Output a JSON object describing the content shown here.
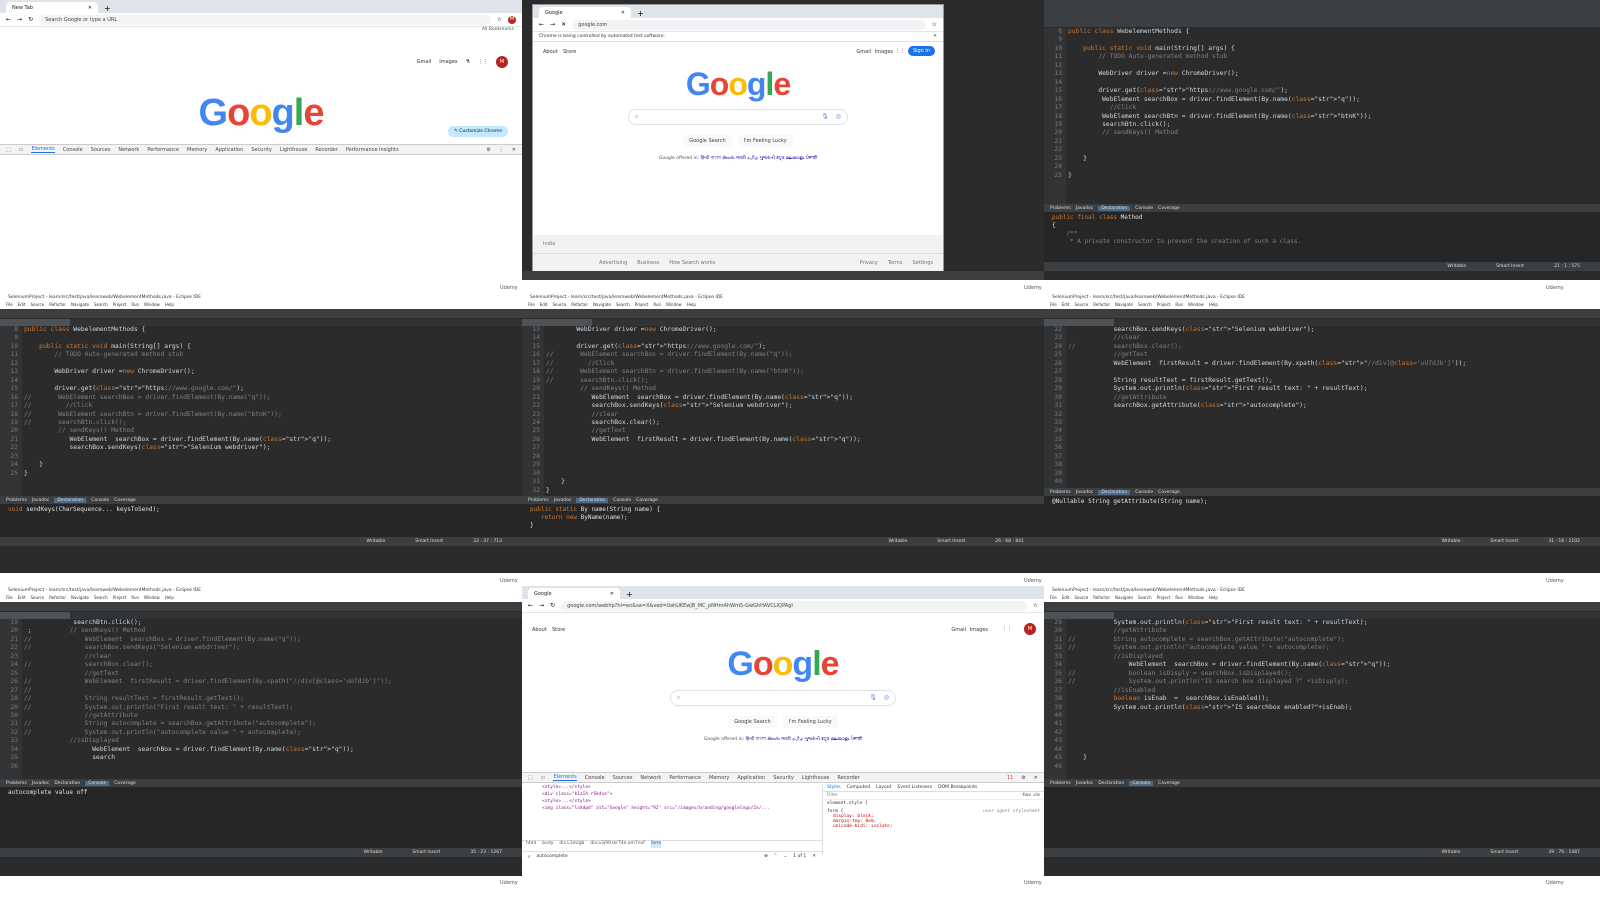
{
  "watermark": "Udemy",
  "tile1": {
    "tab_title": "New Tab",
    "omnibox_placeholder": "Search Google or type a URL",
    "all_bookmarks": "All Bookmarks",
    "top_links": [
      "Gmail",
      "Images"
    ],
    "avatar_letter": "M",
    "customize_button": "Customize Chrome",
    "devtools_tabs": [
      "Elements",
      "Console",
      "Sources",
      "Network",
      "Performance",
      "Memory",
      "Application",
      "Security",
      "Lighthouse",
      "Recorder",
      "Performance insights"
    ]
  },
  "tile2": {
    "tab_title": "Google",
    "url": "google.com",
    "automation_notice": "Chrome is being controlled by automated test software.",
    "top_left_links": [
      "About",
      "Store"
    ],
    "top_right_links": [
      "Gmail",
      "Images"
    ],
    "sign_in": "Sign in",
    "buttons": [
      "Google Search",
      "I'm Feeling Lucky"
    ],
    "offered_in_label": "Google offered in:",
    "languages": [
      "हिन्दी",
      "বাংলা",
      "తెలుగు",
      "मराठी",
      "தமிழ்",
      "ગુજરાતી",
      "ಕನ್ನಡ",
      "മലയാളം",
      "ਪੰਜਾਬੀ"
    ],
    "country": "India",
    "footer_left": [
      "Advertising",
      "Business",
      "How Search works"
    ],
    "footer_right": [
      "Privacy",
      "Terms",
      "Settings"
    ]
  },
  "tile3": {
    "code_lines": [
      {
        "n": "8",
        "t": "public class WebelementMethods {"
      },
      {
        "n": "9",
        "t": ""
      },
      {
        "n": "10",
        "t": "    public static void main(String[] args) {"
      },
      {
        "n": "11",
        "t": "        // TODO Auto-generated method stub"
      },
      {
        "n": "12",
        "t": ""
      },
      {
        "n": "13",
        "t": "        WebDriver driver =new ChromeDriver();"
      },
      {
        "n": "14",
        "t": ""
      },
      {
        "n": "15",
        "t": "        driver.get(\"https://www.google.com/\");"
      },
      {
        "n": "16",
        "t": "         WebElement searchBox = driver.findElement(By.name(\"q\"));"
      },
      {
        "n": "17",
        "t": "           //Click"
      },
      {
        "n": "18",
        "t": "         WebElement searchBtn = driver.findElement(By.name(\"btnK\"));"
      },
      {
        "n": "19",
        "t": "         searchBtn.click();"
      },
      {
        "n": "20",
        "t": "         // sendKeys() Method"
      },
      {
        "n": "21",
        "t": ""
      },
      {
        "n": "22",
        "t": ""
      },
      {
        "n": "23",
        "t": "    }"
      },
      {
        "n": "24",
        "t": ""
      },
      {
        "n": "25",
        "t": "}"
      }
    ],
    "bottom_tabs": [
      "Problems",
      "Javadoc",
      "Declaration",
      "Console",
      "Coverage"
    ],
    "console_lines": [
      "public final class Method",
      "{",
      "    /**",
      "     * A private constructor to prevent the creation of such a class."
    ],
    "status": [
      "Writable",
      "Smart Insert",
      "21 : 1 : 575"
    ]
  },
  "tile4": {
    "title": "SeleniumProject - learn/src/test/java/learnweb/WebelementMethods.java - Eclipse IDE",
    "menu": [
      "File",
      "Edit",
      "Source",
      "Refactor",
      "Navigate",
      "Search",
      "Project",
      "Run",
      "Window",
      "Help"
    ],
    "code_lines": [
      {
        "n": "8",
        "t": "public class WebelementMethods {"
      },
      {
        "n": "9",
        "t": ""
      },
      {
        "n": "10",
        "t": "    public static void main(String[] args) {"
      },
      {
        "n": "11",
        "t": "        // TODO Auto-generated method stub"
      },
      {
        "n": "12",
        "t": ""
      },
      {
        "n": "13",
        "t": "        WebDriver driver =new ChromeDriver();"
      },
      {
        "n": "14",
        "t": ""
      },
      {
        "n": "15",
        "t": "        driver.get(\"https://www.google.com/\");"
      },
      {
        "n": "16",
        "t": "//       WebElement searchBox = driver.findElement(By.name(\"q\"));"
      },
      {
        "n": "17",
        "t": "//         //Click"
      },
      {
        "n": "18",
        "t": "//       WebElement searchBtn = driver.findElement(By.name(\"btnK\"));"
      },
      {
        "n": "19",
        "t": "//       searchBtn.click();"
      },
      {
        "n": "20",
        "t": "         // sendKeys() Method"
      },
      {
        "n": "21",
        "t": "            WebElement  searchBox = driver.findElement(By.name(\"q\"));"
      },
      {
        "n": "22",
        "t": "            searchBox.sendKeys(\"Selenium webdriver\");"
      },
      {
        "n": "23",
        "t": ""
      },
      {
        "n": "24",
        "t": "    }"
      },
      {
        "n": "25",
        "t": "}"
      }
    ],
    "console_lines": [
      "void sendKeys(CharSequence... keysToSend);"
    ],
    "status": [
      "Writable",
      "Smart Insert",
      "22 : 37 : 713"
    ]
  },
  "tile5": {
    "code_lines": [
      {
        "n": "13",
        "t": "        WebDriver driver =new ChromeDriver();"
      },
      {
        "n": "14",
        "t": ""
      },
      {
        "n": "15",
        "t": "        driver.get(\"https://www.google.com/\");"
      },
      {
        "n": "16",
        "t": "//       WebElement searchBox = driver.findElement(By.name(\"q\"));"
      },
      {
        "n": "17",
        "t": "//         //Click"
      },
      {
        "n": "18",
        "t": "//       WebElement searchBtn = driver.findElement(By.name(\"btnK\"));"
      },
      {
        "n": "19",
        "t": "//       searchBtn.click();"
      },
      {
        "n": "20",
        "t": "         // sendKeys() Method"
      },
      {
        "n": "21",
        "t": "            WebElement  searchBox = driver.findElement(By.name(\"q\"));"
      },
      {
        "n": "22",
        "t": "            searchBox.sendKeys(\"Selenium webdriver\");"
      },
      {
        "n": "23",
        "t": "            //clear"
      },
      {
        "n": "24",
        "t": "            searchBox.clear();"
      },
      {
        "n": "25",
        "t": "            //getText"
      },
      {
        "n": "26",
        "t": "            WebElement  firstResult = driver.findElement(By.name(\"q\"));"
      },
      {
        "n": "27",
        "t": ""
      },
      {
        "n": "28",
        "t": ""
      },
      {
        "n": "29",
        "t": ""
      },
      {
        "n": "30",
        "t": ""
      },
      {
        "n": "31",
        "t": "    }"
      },
      {
        "n": "32",
        "t": "}"
      }
    ],
    "console_lines": [
      "public static By name(String name) {",
      "   return new ByName(name);",
      "}"
    ],
    "status": [
      "Writable",
      "Smart Insert",
      "26 : 68 : 841"
    ]
  },
  "tile6": {
    "code_lines": [
      {
        "n": "22",
        "t": "            searchBox.sendKeys(\"Selenium webdriver\");"
      },
      {
        "n": "23",
        "t": "            //clear"
      },
      {
        "n": "24",
        "t": "//          searchBox.clear();"
      },
      {
        "n": "25",
        "t": "            //getText"
      },
      {
        "n": "26",
        "t": "            WebElement  firstResult = driver.findElement(By.xpath(\"//div[@class='uU7dJb']\"));"
      },
      {
        "n": "27",
        "t": ""
      },
      {
        "n": "28",
        "t": "            String resultText = firstResult.getText();"
      },
      {
        "n": "29",
        "t": "            System.out.println(\"First result text: \" + resultText);"
      },
      {
        "n": "30",
        "t": "            //getAttribute"
      },
      {
        "n": "31",
        "t": "            searchBox.getAttribute(\"autocomplete\");"
      },
      {
        "n": "32",
        "t": ""
      },
      {
        "n": "33",
        "t": ""
      },
      {
        "n": "34",
        "t": ""
      },
      {
        "n": "35",
        "t": ""
      },
      {
        "n": "36",
        "t": ""
      },
      {
        "n": "37",
        "t": ""
      },
      {
        "n": "38",
        "t": ""
      },
      {
        "n": "39",
        "t": ""
      },
      {
        "n": "40",
        "t": ""
      }
    ],
    "console_lines": [
      "@Nullable String getAttribute(String name);"
    ],
    "status": [
      "Writable",
      "Smart Insert",
      "31 : 16 : 1102"
    ]
  },
  "tile7": {
    "code_lines": [
      {
        "n": "19",
        "t": "             searchBtn.click();"
      },
      {
        "n": "20",
        "t": " ;          // sendKeys() Method"
      },
      {
        "n": "21",
        "t": "//              WebElement  searchBox = driver.findElement(By.name(\"q\"));"
      },
      {
        "n": "22",
        "t": "//              searchBox.sendKeys(\"Selenium webdriver\");"
      },
      {
        "n": "23",
        "t": "                //clear"
      },
      {
        "n": "24",
        "t": "//              searchBox.clear();"
      },
      {
        "n": "25",
        "t": "                //getText"
      },
      {
        "n": "26",
        "t": "//              WebElement  firstResult = driver.findElement(By.xpath(\"//div[@class='uU7dJb']\"));"
      },
      {
        "n": "27",
        "t": "//"
      },
      {
        "n": "28",
        "t": "//              String resultText = firstResult.getText();"
      },
      {
        "n": "29",
        "t": "//              System.out.println(\"First result text: \" + resultText);"
      },
      {
        "n": "30",
        "t": "                //getAttribute"
      },
      {
        "n": "31",
        "t": "//              String autocomplete = searchBox.getAttribute(\"autocomplete\");"
      },
      {
        "n": "32",
        "t": "//              System.out.println(\"autocomplete value \" + autocomplete);"
      },
      {
        "n": "33",
        "t": "            //isDisplayed"
      },
      {
        "n": "34",
        "t": "                  WebElement  searchBox = driver.findElement(By.name(\"q\"));"
      },
      {
        "n": "35",
        "t": "                  search"
      },
      {
        "n": "36",
        "t": ""
      }
    ],
    "console_lines": [
      "autocomplete value off"
    ],
    "status": [
      "Writable",
      "Smart Insert",
      "35 : 23 : 1267"
    ]
  },
  "tile8": {
    "tab_title": "Google",
    "url": "google.com/webhp?hl=en&sa=X&ved=0ahUKEwjB_MC_pNHmAhWm5-GwGhHAVCLIQPAgI",
    "top_left_links": [
      "About",
      "Store"
    ],
    "top_right_links": [
      "Gmail",
      "Images"
    ],
    "avatar_letter": "M",
    "buttons": [
      "Google Search",
      "I'm Feeling Lucky"
    ],
    "offered_in_label": "Google offered in:",
    "devtools_tabs": [
      "Elements",
      "Console",
      "Sources",
      "Network",
      "Performance",
      "Memory",
      "Application",
      "Security",
      "Lighthouse",
      "Recorder"
    ],
    "errors_badge": "11",
    "styles_tabs": [
      "Styles",
      "Computed",
      "Layout",
      "Event Listeners",
      "DOM Breakpoints"
    ],
    "filter_placeholder": "Filter",
    "hov_cls": ":hov .cls",
    "dom_lines": [
      "<style>...</style>",
      "<div class=\"k1zIA rSk4se\">",
      "<style>...</style>",
      "<img class=\"lnXdpd\" alt=\"Google\" height=\"92\" src=\"/images/branding/googlelogo/2x/..."
    ],
    "element_style": "element.style {",
    "css_rule": "form {",
    "css_props": [
      "display: block;",
      "margin-top: 0em;",
      "unicode-bidi: isolate;"
    ],
    "user_agent_label": "user agent stylesheet",
    "breadcrumbs": [
      "html",
      "body",
      "div.L3eUgb",
      "div.o3j99.ikrT4e.om7nvf",
      "form"
    ],
    "find_value": "autocomplete",
    "find_count": "1 of 1"
  },
  "tile9": {
    "code_lines": [
      {
        "n": "29",
        "t": "            System.out.println(\"First result text: \" + resultText);"
      },
      {
        "n": "30",
        "t": "            //getAttribute"
      },
      {
        "n": "31",
        "t": "//          String autocomplete = searchBox.getAttribute(\"autocomplete\");"
      },
      {
        "n": "32",
        "t": "//          System.out.println(\"autocomplete value \" + autocomplete);"
      },
      {
        "n": "33",
        "t": "            //isDisplayed"
      },
      {
        "n": "34",
        "t": "                WebElement  searchBox = driver.findElement(By.name(\"q\"));"
      },
      {
        "n": "35",
        "t": "//              boolean isDisply = searchBox.isDisplayed();"
      },
      {
        "n": "36",
        "t": "//              System.out.println(\"IS search box displayed ?\" +isDisply);"
      },
      {
        "n": "37",
        "t": "            //isEnabled"
      },
      {
        "n": "38",
        "t": "            boolean isEnab  =  searchBox.isEnabled();"
      },
      {
        "n": "39",
        "t": "            System.out.println(\"IS searchbox enabled?\"+isEnab);"
      },
      {
        "n": "40",
        "t": ""
      },
      {
        "n": "41",
        "t": ""
      },
      {
        "n": "42",
        "t": ""
      },
      {
        "n": "43",
        "t": ""
      },
      {
        "n": "44",
        "t": ""
      },
      {
        "n": "45",
        "t": "    }"
      },
      {
        "n": "46",
        "t": ""
      }
    ],
    "status": [
      "Writable",
      "Smart Insert",
      "39 : 76 : 1487"
    ]
  }
}
